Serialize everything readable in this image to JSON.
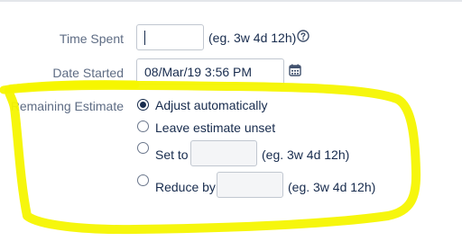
{
  "form": {
    "time_spent": {
      "label": "Time Spent",
      "value": "",
      "hint": "(eg. 3w 4d 12h)"
    },
    "date_started": {
      "label": "Date Started",
      "value": "08/Mar/19 3:56 PM"
    },
    "remaining_estimate": {
      "label": "Remaining Estimate",
      "options": [
        {
          "label": "Adjust automatically",
          "checked": true
        },
        {
          "label": "Leave estimate unset",
          "checked": false
        },
        {
          "label": "Set to",
          "hint": "(eg. 3w 4d 12h)",
          "checked": false
        },
        {
          "label": "Reduce by",
          "hint": "(eg. 3w 4d 12h)",
          "checked": false
        }
      ]
    }
  },
  "icons": {
    "help": "help-icon",
    "calendar": "calendar-icon"
  },
  "colors": {
    "highlight": "#f6f600",
    "label": "#5e6c84",
    "text": "#172b4d",
    "border": "#c1c7d0"
  }
}
